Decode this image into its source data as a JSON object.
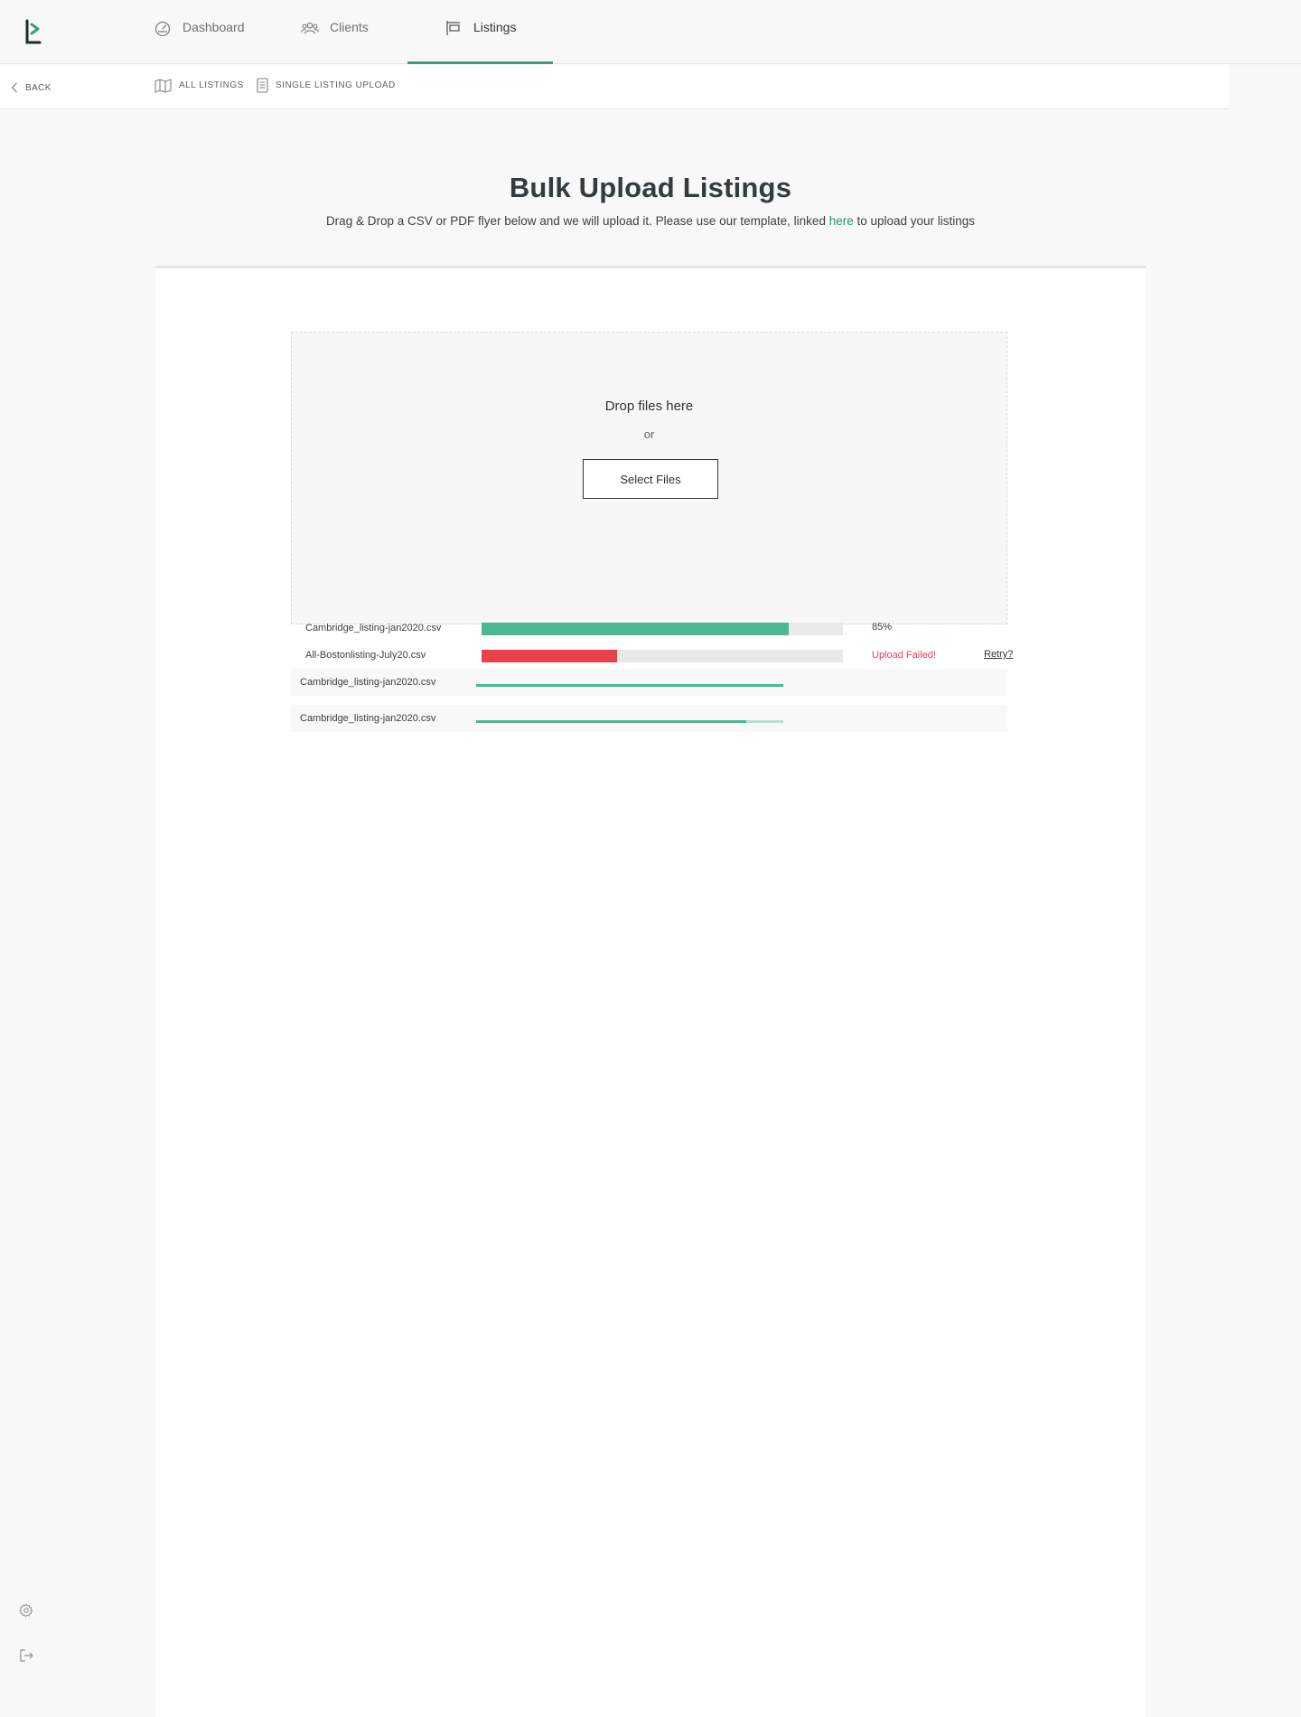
{
  "nav": {
    "items": [
      {
        "label": "Dashboard",
        "icon": "gauge-icon"
      },
      {
        "label": "Clients",
        "icon": "users-icon"
      },
      {
        "label": "Listings",
        "icon": "sign-icon",
        "active": true
      }
    ],
    "accent": "#3e9a79"
  },
  "subnav": {
    "back": "BACK",
    "items": [
      {
        "label": "ALL LISTINGS",
        "icon": "map-icon"
      },
      {
        "label": "SINGLE LISTING UPLOAD",
        "icon": "document-icon"
      }
    ]
  },
  "header": {
    "title": "Bulk Upload Listings",
    "subtitle_before": "Drag & Drop a CSV or PDF flyer below and we will upload it. Please use our template, linked ",
    "subtitle_link": "here",
    "subtitle_after": " to upload your listings"
  },
  "dropzone": {
    "title": "Drop files here",
    "or": "or",
    "button": "Select Files"
  },
  "uploads": [
    {
      "filename": "Cambridge_listing-jan2020.csv",
      "progress": 0.85,
      "status_text": "85%",
      "status": "uploading"
    },
    {
      "filename": "All-Bostonlisting-July20.csv",
      "progress": 0.375,
      "status_text": "Upload Failed!",
      "status": "failed",
      "retry": "Retry?"
    }
  ],
  "queue": [
    {
      "filename": "Cambridge_listing-jan2020.csv",
      "progress": 1.0
    },
    {
      "filename": "Cambridge_listing-jan2020.csv",
      "progress": 0.88
    }
  ],
  "colors": {
    "success": "#4db88f",
    "error": "#e8414b",
    "link": "#2e8f6d"
  }
}
